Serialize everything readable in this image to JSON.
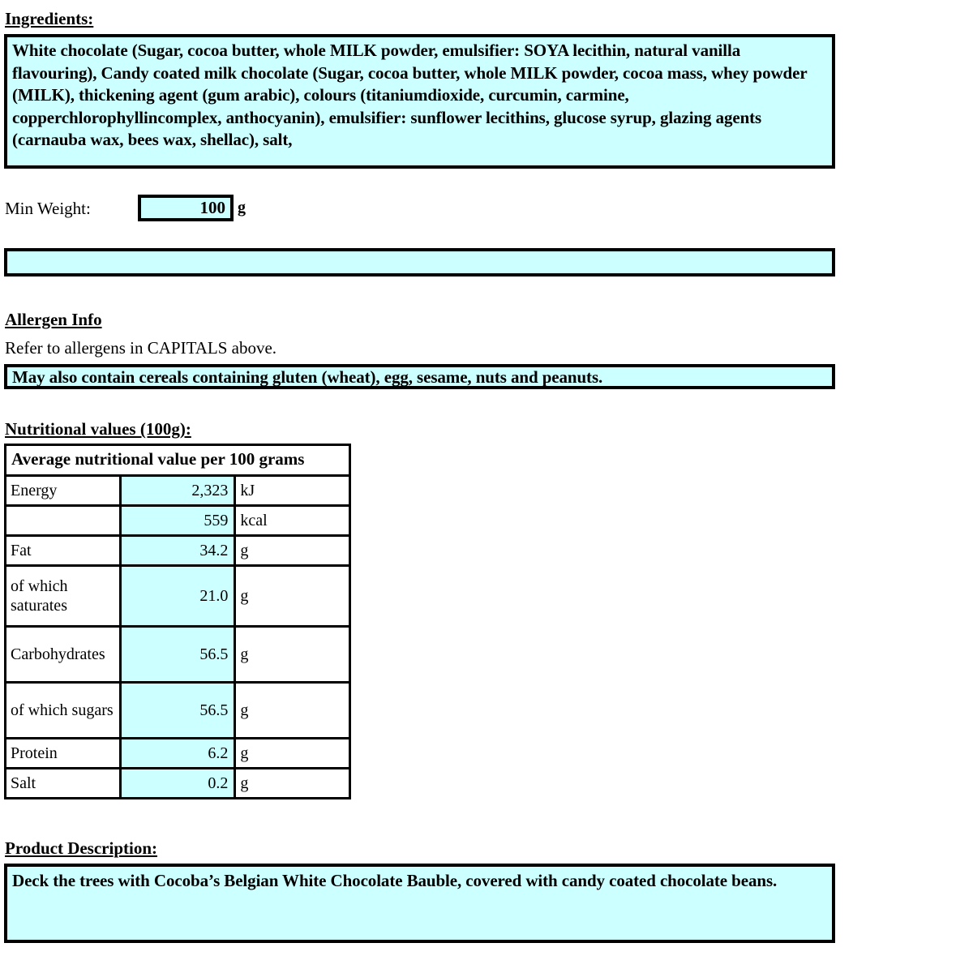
{
  "ingredients": {
    "heading": "Ingredients:",
    "text": "White chocolate (Sugar, cocoa butter, whole MILK powder, emulsifier: SOYA lecithin, natural vanilla flavouring), Candy coated milk chocolate (Sugar, cocoa butter, whole MILK powder, cocoa mass, whey powder (MILK), thickening agent (gum arabic), colours (titaniumdioxide, curcumin, carmine, copperchlorophyllincomplex, anthocyanin), emulsifier: sunflower lecithins, glucose syrup, glazing agents (carnauba wax, bees wax, shellac), salt,"
  },
  "min_weight": {
    "label": "Min Weight:",
    "value": "100",
    "unit": "g"
  },
  "empty_bar": {
    "value": ""
  },
  "allergen": {
    "heading": "Allergen Info",
    "note": "Refer to allergens in CAPITALS above.",
    "may_contain": "May also contain cereals containing gluten (wheat), egg, sesame, nuts and peanuts."
  },
  "nutrition": {
    "heading": "Nutritional values (100g):",
    "table_header": "Average nutritional value per 100 grams",
    "rows": [
      {
        "label": "Energy",
        "value": "2,323",
        "unit": "kJ"
      },
      {
        "label": "",
        "value": "559",
        "unit": "kcal"
      },
      {
        "label": "Fat",
        "value": "34.2",
        "unit": "g"
      },
      {
        "label": "of which saturates",
        "value": "21.0",
        "unit": "g"
      },
      {
        "label": "Carbohydrates",
        "value": "56.5",
        "unit": "g"
      },
      {
        "label": "of which sugars",
        "value": "56.5",
        "unit": "g"
      },
      {
        "label": "Protein",
        "value": "6.2",
        "unit": "g"
      },
      {
        "label": "Salt",
        "value": "0.2",
        "unit": "g"
      }
    ]
  },
  "description": {
    "heading": "Product Description:",
    "text": "Deck the trees with Cocoba’s Belgian White Chocolate Bauble, covered with candy coated chocolate beans."
  },
  "colors": {
    "fill": "#CCFFFF",
    "border": "#000000",
    "text": "#000000",
    "background": "#FFFFFF"
  }
}
